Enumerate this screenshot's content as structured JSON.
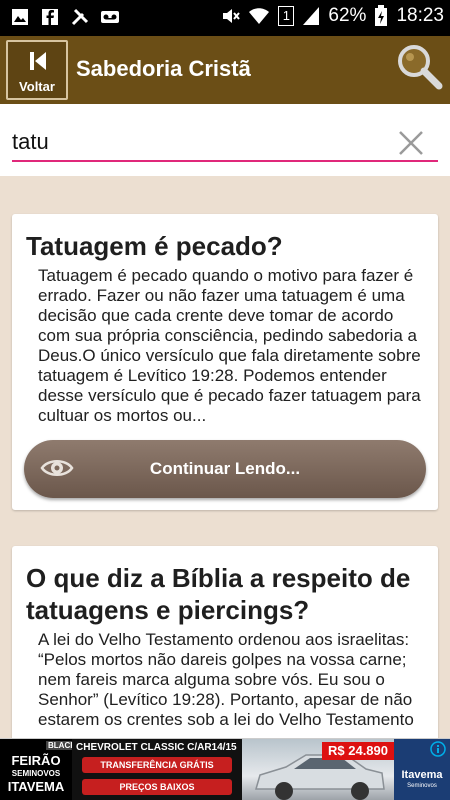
{
  "status_bar": {
    "battery": "62%",
    "time": "18:23",
    "sim_slot": "1"
  },
  "app_bar": {
    "back_label": "Voltar",
    "title": "Sabedoria Cristã"
  },
  "search": {
    "value": "tatu",
    "accent_color": "#e0287a"
  },
  "results": [
    {
      "title": "Tatuagem é pecado?",
      "excerpt": "Tatuagem é pecado quando o motivo para fazer é errado. Fazer ou não fazer uma tatuagem é uma decisão que cada crente deve tomar de acordo com sua própria consciência, pedindo sabedoria a Deus.O único versículo que fala diretamente sobre tatuagem é Levítico 19:28. Podemos entender desse versículo que é pecado fazer tatuagem para cultuar os mortos ou...",
      "read_more_label": "Continuar Lendo..."
    },
    {
      "title": "O que diz a Bíblia a respeito de tatuagens e piercings?",
      "excerpt": "A lei do Velho Testamento ordenou aos israelitas: “Pelos mortos não dareis golpes na vossa carne; nem fareis marca alguma sobre vós. Eu sou o Senhor” (Levítico 19:28). Portanto, apesar de não estarem os crentes sob a lei do Velho Testamento"
    }
  ],
  "ad": {
    "logo_badge": "BLACK",
    "logo_line1": "FEIRÃO",
    "logo_line2": "SEMINOVOS",
    "logo_line3": "ITAVEMA",
    "model": "CHEVROLET CLASSIC C/AR14/15",
    "offer1": "TRANSFERÊNCIA GRÁTIS",
    "offer2": "PREÇOS BAIXOS",
    "price": "R$ 24.890",
    "brand": "Itavema",
    "brand_sub": "Seminovos"
  },
  "colors": {
    "app_bar": "#6b4e16",
    "background": "#ecdfd1",
    "read_more_button": "#7d695c"
  }
}
